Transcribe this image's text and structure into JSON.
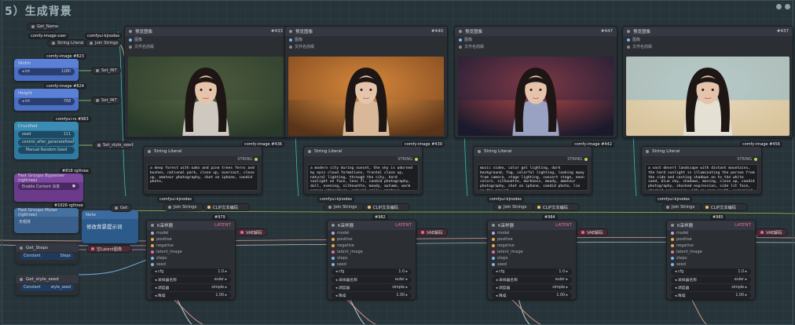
{
  "group": {
    "title": "5）生成背景"
  },
  "images": [
    {
      "node_title": "预览图像",
      "node_id": "#433",
      "out1": "图像",
      "out2": "文件名前缀",
      "tag": "comfy-image",
      "tag_id": "#436",
      "sky": "#3a4632",
      "bg": "#2a3a2a",
      "glow": "#5b6b46",
      "shirt": "#cfc8c0"
    },
    {
      "node_title": "预览图像",
      "node_id": "#440",
      "out1": "图像",
      "out2": "文件名前缀",
      "tag": "comfy-image",
      "tag_id": "#439",
      "sky": "#b4682a",
      "bg": "#5a3418",
      "glow": "#f2a04a",
      "shirt": "#d8b898"
    },
    {
      "node_title": "预览图像",
      "node_id": "#447",
      "out1": "图像",
      "out2": "文件名前缀",
      "tag": "comfy-image",
      "tag_id": "#442",
      "sky": "#2a2440",
      "bg": "#1a1a2c",
      "glow": "#c24a4a",
      "shirt": "#9aa2c4"
    },
    {
      "node_title": "预览图像",
      "node_id": "#437",
      "out1": "图像",
      "out2": "文件名前缀",
      "tag": "comfy-image",
      "tag_id": "#456",
      "sky": "#7ab4d4",
      "bg": "#d8c49c",
      "glow": "#e8dcc0",
      "shirt": "#e4e0d4"
    }
  ],
  "prompts": [
    {
      "title": "String Literal",
      "out": "STRING",
      "text": "a deep forest with oaks and pine trees ferns and bushes, national park, close up, overcast, close up, amateur photography, shot on iphone, candid photo,"
    },
    {
      "title": "String Literal",
      "out": "STRING",
      "text": "a modern city during sunset, the sky is adorned by epic cloud formations, frontal close up, natural lighting, through the city, hard sunlight on face, lens fl, candid photography, dull, evening, silhouette, moody, autumn, warm orange atmosphere, natural smile, amateur photography, shot on iphone, candid"
    },
    {
      "title": "String Literal",
      "out": "STRING",
      "text": "music video, color gel lighting, dark background, fog, colorful lighting, looking away from camera, stage lighting, concert stage, neon colors, silhouette, darkness, moody, amateur photography, shot on iphone, candid photo, lie on the ground"
    },
    {
      "title": "String Literal",
      "out": "STRING",
      "text": "a vast desert landscape with distant mountains, the hard sunlight is illuminating the person from the side and casting shadows on to the white sand, blue sky, shadows, moving, close up, candid photography, shocked expression, side lit face, shocked expression with an open mouth, surprised"
    }
  ],
  "joins": [
    {
      "tag": "comfyui-kjnodes",
      "label": "Join Strings",
      "clip": "CLIP文本编码"
    },
    {
      "tag": "comfyui-kjnodes",
      "label": "Join Strings",
      "clip": "CLIP文本编码"
    },
    {
      "tag": "comfyui-kjnodes",
      "label": "Join Strings",
      "clip": "CLIP文本编码"
    },
    {
      "tag": "comfyui-kjnodes",
      "label": "Join Strings",
      "clip": "CLIP文本编码"
    }
  ],
  "samplers": [
    {
      "title": "K采样器",
      "id": "#979",
      "latent": "LATENT",
      "vae": "VAE解码",
      "ports": [
        "model",
        "positive",
        "negative",
        "latent_image",
        "steps",
        "seed"
      ],
      "widgets": [
        [
          "cfg",
          "1.0"
        ],
        [
          "采样器名称",
          "euler"
        ],
        [
          "调度器",
          "simple"
        ],
        [
          "降噪",
          "1.00"
        ]
      ]
    },
    {
      "title": "K采样器",
      "id": "#982",
      "latent": "LATENT",
      "vae": "VAE解码",
      "ports": [
        "model",
        "positive",
        "negative",
        "latent_image",
        "steps",
        "seed"
      ],
      "widgets": [
        [
          "cfg",
          "1.0"
        ],
        [
          "采样器名称",
          "euler"
        ],
        [
          "调度器",
          "simple"
        ],
        [
          "降噪",
          "1.00"
        ]
      ]
    },
    {
      "title": "K采样器",
      "id": "#984",
      "latent": "LATENT",
      "vae": "VAE解码",
      "ports": [
        "model",
        "positive",
        "negative",
        "latent_image",
        "steps",
        "seed"
      ],
      "widgets": [
        [
          "cfg",
          "1.0"
        ],
        [
          "采样器名称",
          "euler"
        ],
        [
          "调度器",
          "simple"
        ],
        [
          "降噪",
          "1.00"
        ]
      ]
    },
    {
      "title": "K采样器",
      "id": "#985",
      "latent": "LATENT",
      "vae": "VAE解码",
      "ports": [
        "model",
        "positive",
        "negative",
        "latent_image",
        "steps",
        "seed"
      ],
      "widgets": [
        [
          "cfg",
          "1.0"
        ],
        [
          "采样器名称",
          "euler"
        ],
        [
          "调度器",
          "simple"
        ],
        [
          "降噪",
          "1.00"
        ]
      ]
    }
  ],
  "left": {
    "get_name": "Get_Name",
    "comfy_image_user": "comfy-image-user",
    "string_literal": "String Literal",
    "comfyui_kjnodes": "comfyui-kjnodes",
    "join_strings": "Join Strings",
    "width_tag": "comfy-image",
    "width_id": "#823",
    "width_title": "Width",
    "width_val": "1280",
    "width_set": "Set_INT",
    "height_tag": "comfy-image",
    "height_id": "#824",
    "height_title": "Height",
    "height_val": "768",
    "height_set": "Set_INT",
    "seed_tag": "comfyui-rs",
    "seed_id": "#983",
    "seed_title": "Crucified",
    "seed_val": "111",
    "seed_ctrl": "control_after_generate",
    "seed_fixed": "fixed",
    "seed_btn": "Manual Random Seed",
    "seed_set": "Set_style_seed",
    "bypass_tag_id": "#818 rgthree",
    "bypass_title": "Fast Groups Bypasser (rgthree)",
    "bypass_toggle": "Enable Content 背景",
    "muter_tag_id": "#1026 rgthree",
    "muter_title": "Fast Groups Muter (rgthree)",
    "muter_text": "无组体",
    "note_title": "Note",
    "note_text": "修改背景提示词",
    "get_label": "Get",
    "latent_empty": "空Latent图像",
    "get_steps": "Get_Steps",
    "constant_steps": "Constant",
    "steps_val": "Steps",
    "get_seed": "Get_style_seed",
    "constant_seed": "Constant",
    "seed_label2": "style_seed"
  }
}
